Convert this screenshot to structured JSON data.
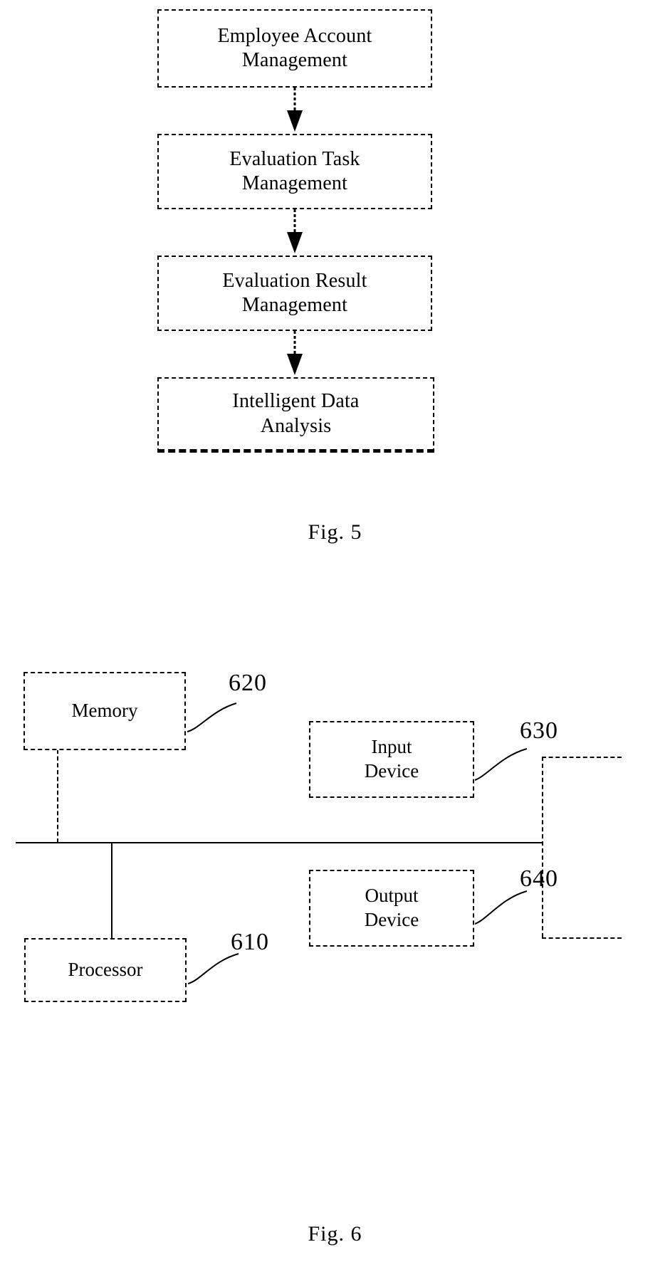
{
  "figure5": {
    "caption": "Fig. 5",
    "type": "flowchart",
    "orientation": "vertical-top-down",
    "boxes": [
      {
        "id": "employee-account-management",
        "line1": "Employee Account",
        "line2": "Management"
      },
      {
        "id": "evaluation-task-management",
        "line1": "Evaluation Task",
        "line2": "Management"
      },
      {
        "id": "evaluation-result-management",
        "line1": "Evaluation Result",
        "line2": "Management"
      },
      {
        "id": "intelligent-data-analysis",
        "line1": "Intelligent Data",
        "line2": "Analysis"
      }
    ],
    "arrows": [
      {
        "from": "employee-account-management",
        "to": "evaluation-task-management"
      },
      {
        "from": "evaluation-task-management",
        "to": "evaluation-result-management"
      },
      {
        "from": "evaluation-result-management",
        "to": "intelligent-data-analysis"
      }
    ]
  },
  "figure6": {
    "caption": "Fig. 6",
    "type": "block-diagram",
    "blocks": [
      {
        "id": "memory",
        "line1": "Memory",
        "line2": "",
        "ref": "620"
      },
      {
        "id": "input-device",
        "line1": "Input",
        "line2": "Device",
        "ref": "630"
      },
      {
        "id": "output-device",
        "line1": "Output",
        "line2": "Device",
        "ref": "640"
      },
      {
        "id": "processor",
        "line1": "Processor",
        "line2": "",
        "ref": "610"
      }
    ],
    "reference_numerals": {
      "memory": "620",
      "input_device": "630",
      "output_device": "640",
      "processor": "610"
    },
    "bus_label": ""
  },
  "style": {
    "ink": "#000000",
    "paper": "#ffffff"
  }
}
